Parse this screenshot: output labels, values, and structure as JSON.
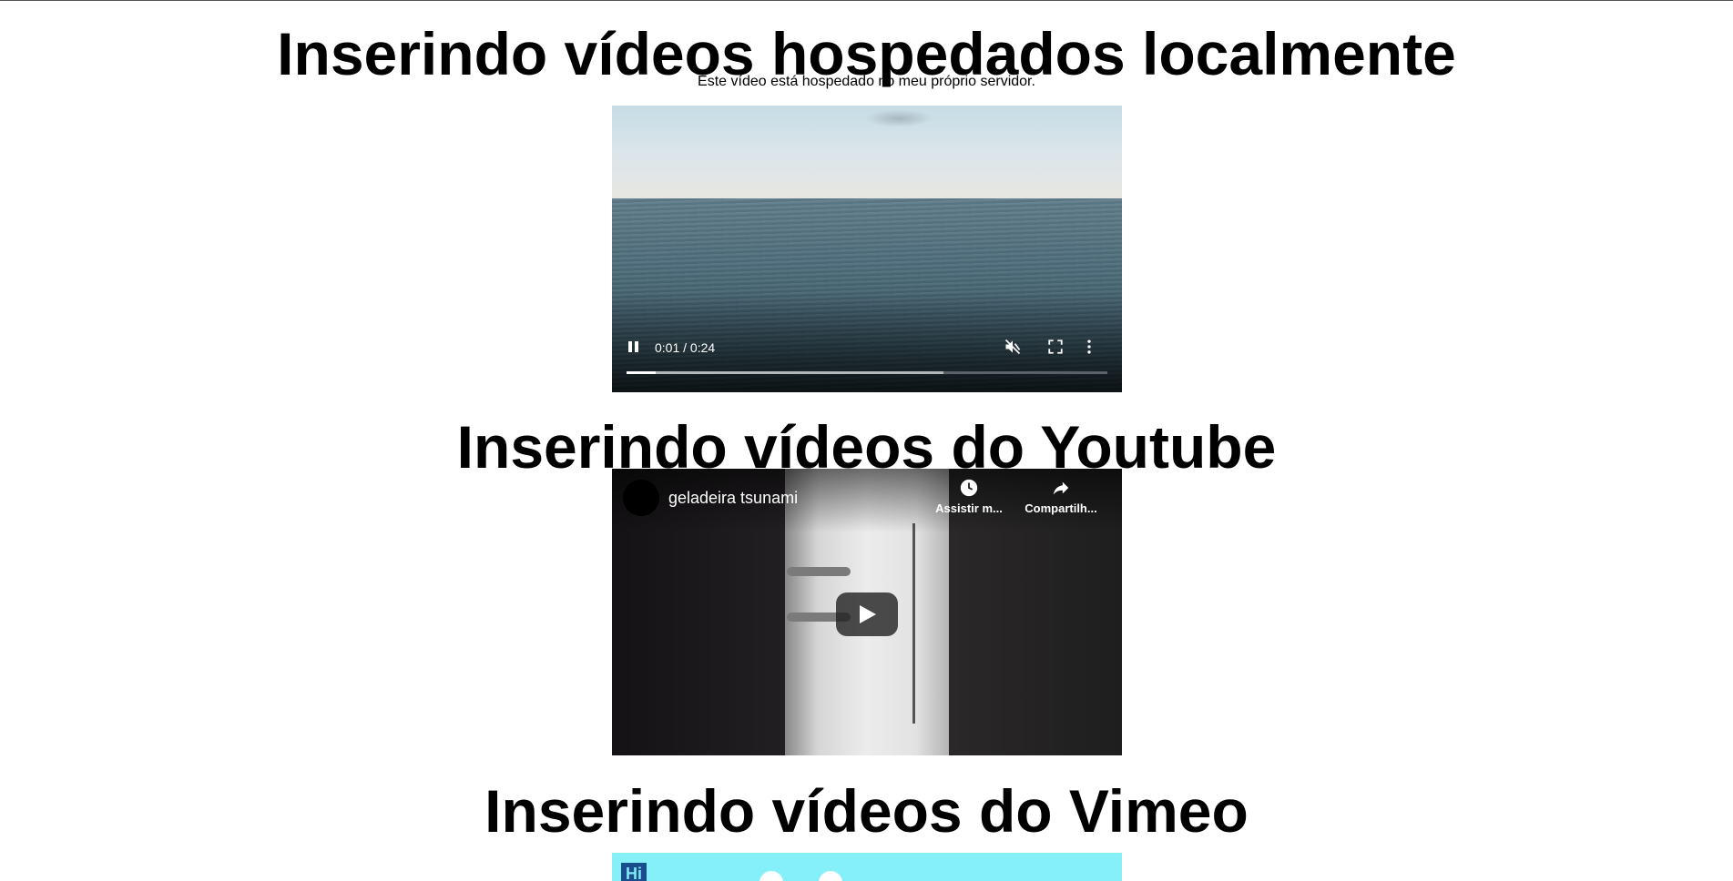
{
  "sections": {
    "local": {
      "heading": "Inserindo vídeos hospedados localmente",
      "description": "Este vídeo está hospedado no meu próprio servidor.",
      "player": {
        "time_display": "0:01 / 0:24",
        "progress_played": 0.06,
        "progress_buffered": 0.66,
        "icons": [
          "pause-icon",
          "mute-icon",
          "fullscreen-icon",
          "more-options-icon"
        ]
      }
    },
    "youtube": {
      "heading": "Inserindo vídeos do Youtube",
      "video_title": "geladeira tsunami",
      "watch_later_label": "Assistir m...",
      "share_label": "Compartilh...",
      "icons": [
        "channel-avatar",
        "clock-icon",
        "share-icon",
        "play-icon"
      ]
    },
    "vimeo": {
      "heading": "Inserindo vídeos do Vimeo",
      "thumbnail_text": "Hi"
    }
  },
  "colors": {
    "page_background": "#ffffff",
    "vimeo_thumbnail": "#86f0f8",
    "vimeo_badge": "#1a4d8c"
  }
}
